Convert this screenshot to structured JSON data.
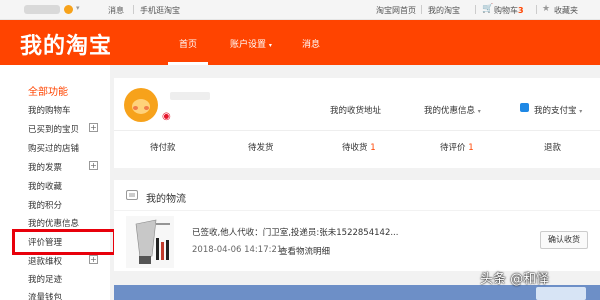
{
  "topbar": {
    "messages": "消息",
    "mobile_taobao": "手机逛淘宝",
    "taobao_home": "淘宝网首页",
    "my_taobao": "我的淘宝",
    "cart_label": "购物车",
    "cart_count": "3",
    "favorites": "收藏夹"
  },
  "header": {
    "logo": "我的淘宝",
    "nav": {
      "home": "首页",
      "account_settings": "账户设置",
      "messages": "消息"
    }
  },
  "sidebar": {
    "title": "全部功能",
    "items": [
      {
        "label": "我的购物车"
      },
      {
        "label": "已买到的宝贝"
      },
      {
        "label": "购买过的店铺"
      },
      {
        "label": "我的发票"
      },
      {
        "label": "我的收藏"
      },
      {
        "label": "我的积分"
      },
      {
        "label": "我的优惠信息"
      },
      {
        "label": "评价管理"
      },
      {
        "label": "退款维权"
      },
      {
        "label": "我的足迹"
      },
      {
        "label": "流量钱包"
      }
    ]
  },
  "profile": {
    "address_link": "我的收货地址",
    "coupon_link": "我的优惠信息",
    "alipay_link": "我的支付宝",
    "stats": {
      "pending_pay": "待付款",
      "pending_ship": "待发货",
      "pending_receive": "待收货",
      "pending_receive_count": "1",
      "pending_review": "待评价",
      "pending_review_count": "1",
      "refund": "退款"
    }
  },
  "logistics": {
    "title": "我的物流",
    "status": "已签收,他人代收：门卫室,投递员:张未1522854142...",
    "date": "2018-04-06 14:17:21",
    "view_link": "查看物流明细",
    "confirm_button": "确认收货"
  },
  "watermark": "头条 @和怿"
}
